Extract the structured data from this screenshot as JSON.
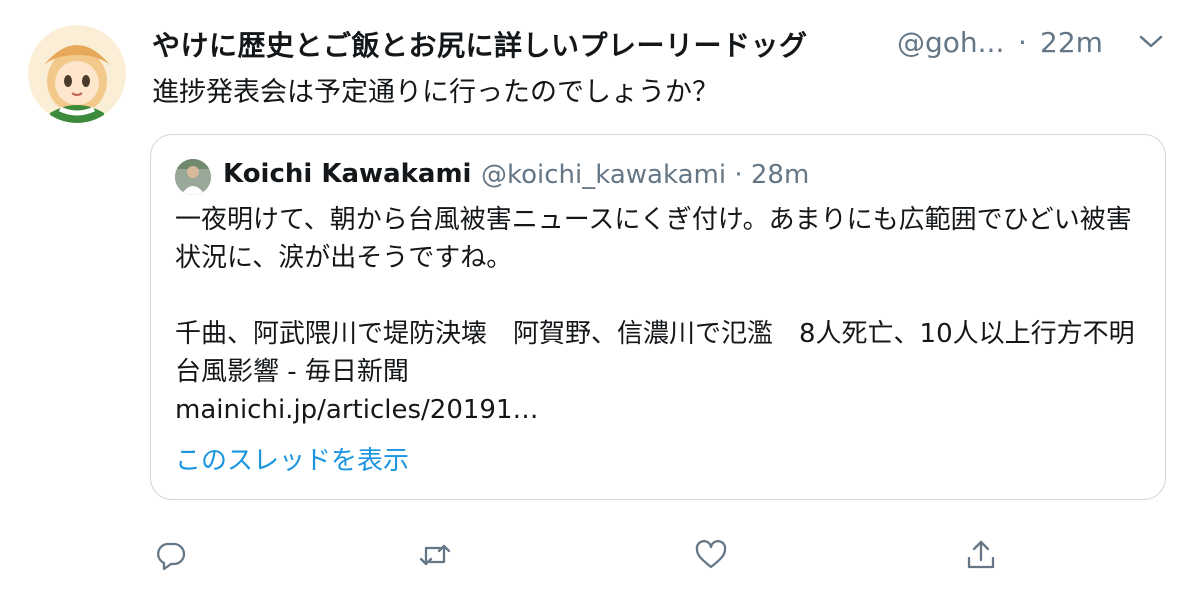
{
  "tweet": {
    "display_name": "やけに歴史とご飯とお尻に詳しいプレーリードッグ",
    "handle": "@goh...",
    "separator": "·",
    "time": "22m",
    "text": "進捗発表会は予定通りに行ったのでしょうか？"
  },
  "quote": {
    "name": "Koichi Kawakami",
    "handle_time": "@koichi_kawakami · 28m",
    "body": "一夜明けて、朝から台風被害ニュースにくぎ付け。あまりにも広範囲でひどい被害状況に、涙が出そうですね。\n\n千曲、阿武隈川で堤防決壊　阿賀野、信濃川で氾濫　8人死亡、10人以上行方不明　台風影響 - 毎日新聞\nmainichi.jp/articles/20191…",
    "show_thread": "このスレッドを表示"
  },
  "actions": [
    "reply-icon",
    "retweet-icon",
    "like-icon",
    "share-icon"
  ],
  "colors": {
    "link": "#1b95e0",
    "secondary": "#657786",
    "border": "#ccd6dd"
  }
}
